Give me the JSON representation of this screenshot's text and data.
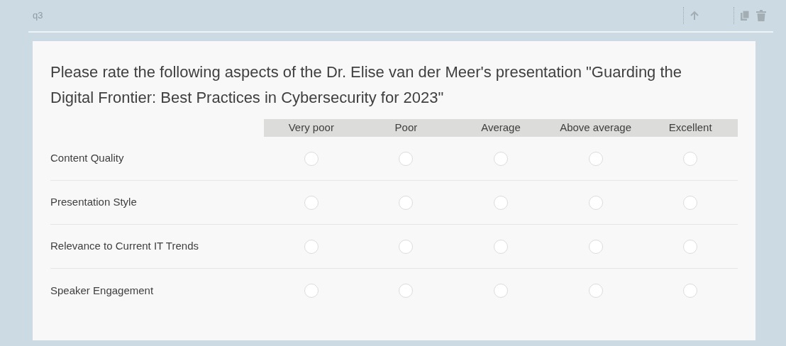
{
  "question": {
    "name": "q3",
    "title": "Please rate the following aspects of the Dr. Elise van der Meer's presentation \"Guarding the Digital Frontier: Best Practices in Cybersecurity for 2023\""
  },
  "columns": [
    "Very poor",
    "Poor",
    "Average",
    "Above average",
    "Excellent"
  ],
  "rows": [
    {
      "label": "Content Quality",
      "options": [
        {
          "selected": false
        },
        {
          "selected": false
        },
        {
          "selected": false
        },
        {
          "selected": false
        },
        {
          "selected": false
        }
      ]
    },
    {
      "label": "Presentation Style",
      "options": [
        {
          "selected": false
        },
        {
          "selected": false
        },
        {
          "selected": false
        },
        {
          "selected": false
        },
        {
          "selected": false
        }
      ]
    },
    {
      "label": "Relevance to Current IT Trends",
      "options": [
        {
          "selected": false
        },
        {
          "selected": false
        },
        {
          "selected": false
        },
        {
          "selected": false
        },
        {
          "selected": false
        }
      ]
    },
    {
      "label": "Speaker Engagement",
      "options": [
        {
          "selected": false
        },
        {
          "selected": false
        },
        {
          "selected": false
        },
        {
          "selected": false
        },
        {
          "selected": false
        }
      ]
    }
  ]
}
